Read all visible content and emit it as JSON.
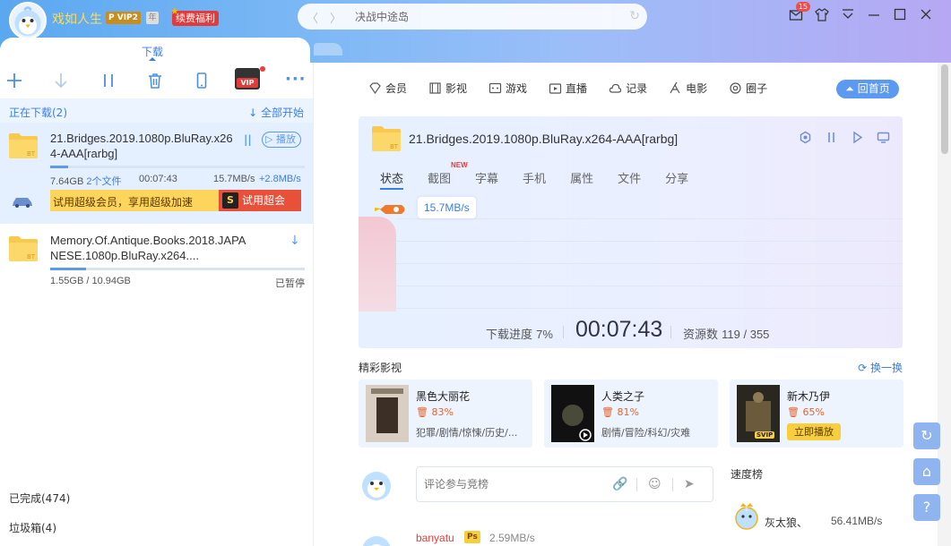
{
  "header": {
    "username": "戏如人生",
    "vip_badge": "P VIP2",
    "vip_badge2": "年",
    "renew_label": "续费福利",
    "search_value": "决战中途岛",
    "notification_count": "15"
  },
  "left": {
    "tab_label": "下载",
    "vip_tool_label": "VIP",
    "downloading_label": "正在下载(2)",
    "start_all_label": "全部开始",
    "tasks": [
      {
        "name": "21.Bridges.2019.1080p.BluRay.x264-AAA[rarbg]",
        "size": "7.64GB",
        "files": "2个文件",
        "eta": "00:07:43",
        "speed": "15.7MB/s",
        "boost": "+2.8MB/s",
        "progress": 0.07,
        "play_label": "播放",
        "promo_text": "试用超级会员，享用超级加速",
        "promo_button": "试用超会",
        "promo_icon": "S"
      },
      {
        "name": "Memory.Of.Antique.Books.2018.JAPANESE.1080p.BluRay.x264....",
        "size": "1.55GB / 10.94GB",
        "status": "已暂停",
        "progress": 0.14
      }
    ],
    "completed_label": "已完成(474)",
    "trash_label": "垃圾箱(4)"
  },
  "main": {
    "nav": [
      {
        "label": "会员",
        "icon": "diamond-icon"
      },
      {
        "label": "影视",
        "icon": "film-icon"
      },
      {
        "label": "游戏",
        "icon": "game-icon"
      },
      {
        "label": "直播",
        "icon": "live-icon"
      },
      {
        "label": "记录",
        "icon": "cloud-icon"
      },
      {
        "label": "电影",
        "icon": "movie-icon"
      },
      {
        "label": "圈子",
        "icon": "circle-icon"
      }
    ],
    "home_label": "回首页",
    "detail": {
      "title": "21.Bridges.2019.1080p.BluRay.x264-AAA[rarbg]",
      "tabs": [
        "状态",
        "截图",
        "字幕",
        "手机",
        "属性",
        "文件",
        "分享"
      ],
      "new_badge": "NEW",
      "speed": "15.7MB/s",
      "progress_label": "下载进度",
      "progress_value": "7%",
      "time_remaining": "00:07:43",
      "resources_label": "资源数",
      "resources_value": "119 / 355"
    },
    "recommend_title": "精彩影视",
    "refresh_label": "换一换",
    "movies": [
      {
        "title": "黑色大丽花",
        "percent": "83%",
        "genres": "犯罪/剧情/惊悚/历史/..."
      },
      {
        "title": "人类之子",
        "percent": "81%",
        "genres": "剧情/冒险/科幻/灾难"
      },
      {
        "title": "新木乃伊",
        "percent": "65%",
        "play_label": "立即播放",
        "badge": "SVIP"
      }
    ],
    "comment_placeholder": "评论参与竞榜",
    "rank_title": "速度榜",
    "rank": [
      {
        "rank": "1",
        "name": "灰太狼、",
        "speed": "56.41MB/s"
      }
    ],
    "comment_user": {
      "name": "banyatu",
      "badge": "Ps",
      "speed": "2.59MB/s"
    }
  },
  "colors": {
    "accent": "#3d7ee3",
    "progress": "#5b9af0",
    "promo": "#fdd55c",
    "promo_button": "#e8503a"
  }
}
